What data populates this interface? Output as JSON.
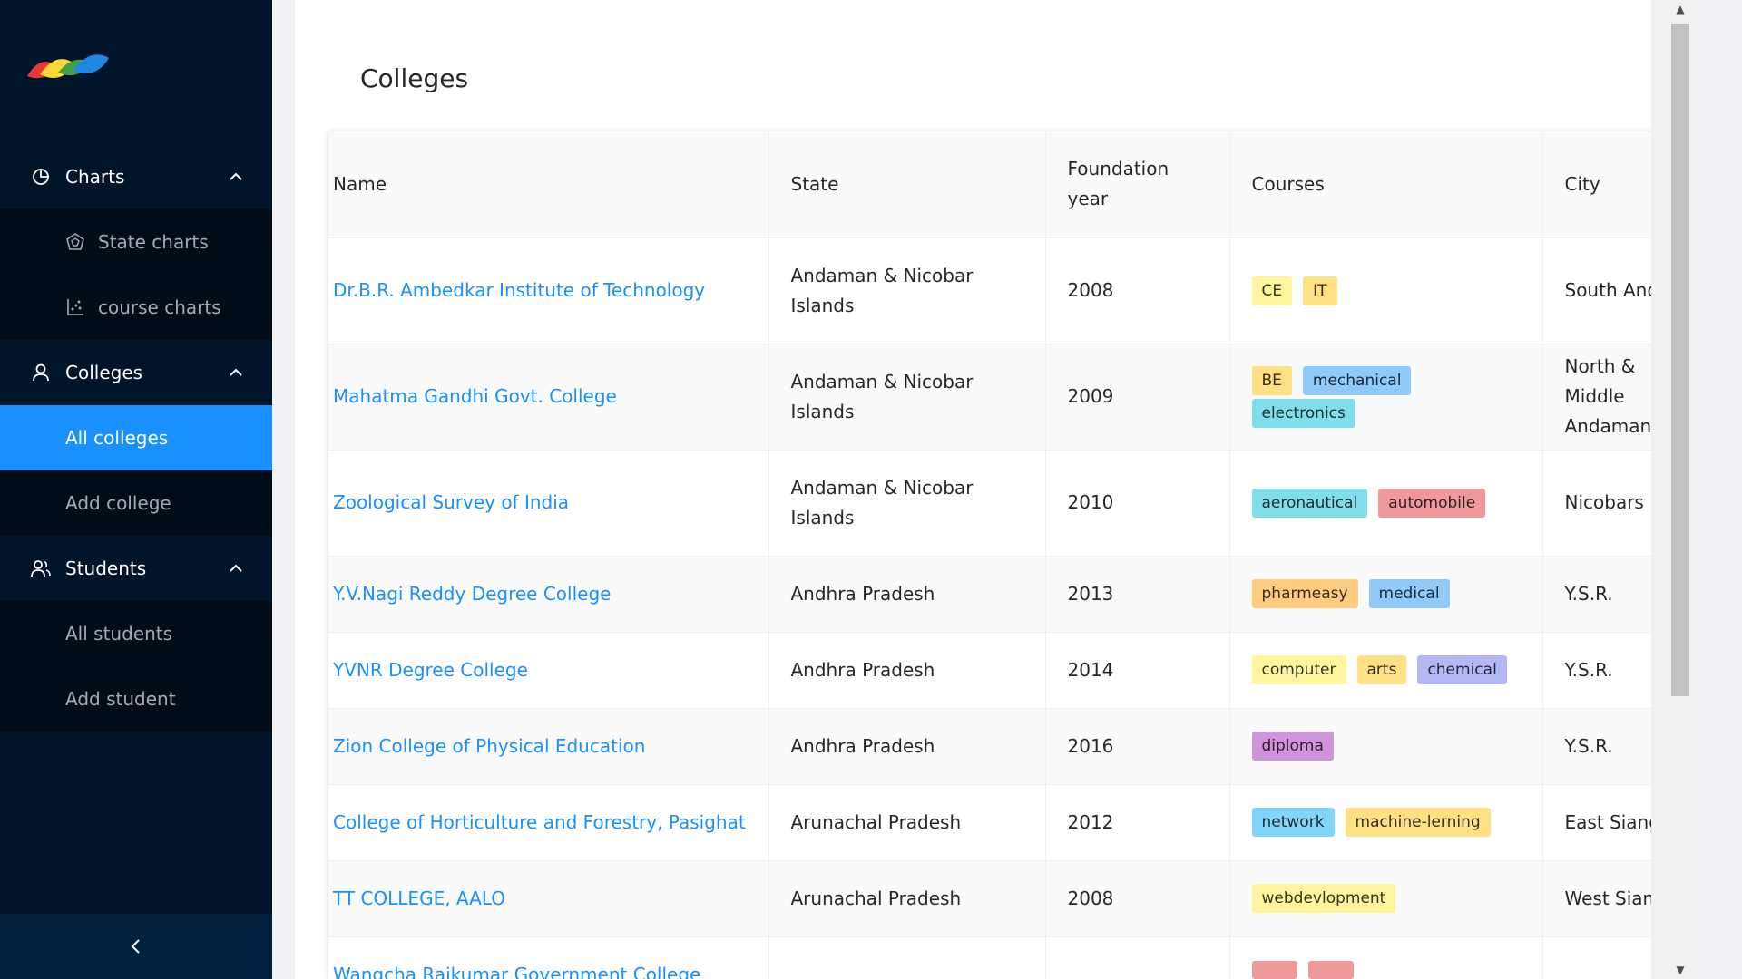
{
  "sidebar": {
    "logo_icon": "colorful-leaves-logo",
    "groups": [
      {
        "label": "Charts",
        "icon": "pie-chart-icon",
        "items": [
          {
            "label": "State charts",
            "icon": "radar-chart-icon"
          },
          {
            "label": "course charts",
            "icon": "scatter-chart-icon"
          }
        ]
      },
      {
        "label": "Colleges",
        "icon": "user-icon",
        "items": [
          {
            "label": "All colleges",
            "active": true
          },
          {
            "label": "Add college"
          }
        ]
      },
      {
        "label": "Students",
        "icon": "team-icon",
        "items": [
          {
            "label": "All students"
          },
          {
            "label": "Add student"
          }
        ]
      }
    ],
    "collapse_icon": "chevron-left-icon"
  },
  "page": {
    "title": "Colleges"
  },
  "table": {
    "columns": [
      "Name",
      "State",
      "Foundation year",
      "Courses",
      "City"
    ],
    "rows": [
      {
        "name": "Dr.B.R. Ambedkar Institute of Technology",
        "state": "Andaman & Nicobar Islands",
        "year": "2008",
        "courses": [
          "CE",
          "IT"
        ],
        "city": "South Andaman"
      },
      {
        "name": "Mahatma Gandhi Govt. College",
        "state": "Andaman & Nicobar Islands",
        "year": "2009",
        "courses": [
          "BE",
          "mechanical",
          "electronics"
        ],
        "city": "North & Middle Andaman"
      },
      {
        "name": "Zoological Survey of India",
        "state": "Andaman & Nicobar Islands",
        "year": "2010",
        "courses": [
          "aeronautical",
          "automobile"
        ],
        "city": "Nicobars"
      },
      {
        "name": "Y.V.Nagi Reddy Degree College",
        "state": "Andhra Pradesh",
        "year": "2013",
        "courses": [
          "pharmeasy",
          "medical"
        ],
        "city": "Y.S.R."
      },
      {
        "name": "YVNR Degree College",
        "state": "Andhra Pradesh",
        "year": "2014",
        "courses": [
          "computer",
          "arts",
          "chemical"
        ],
        "city": "Y.S.R."
      },
      {
        "name": "Zion College of Physical Education",
        "state": "Andhra Pradesh",
        "year": "2016",
        "courses": [
          "diploma"
        ],
        "city": "Y.S.R."
      },
      {
        "name": "College of Horticulture and Forestry, Pasighat",
        "state": "Arunachal Pradesh",
        "year": "2012",
        "courses": [
          "network",
          "machine-lerning"
        ],
        "city": "East Siang"
      },
      {
        "name": "TT COLLEGE, AALO",
        "state": "Arunachal Pradesh",
        "year": "2008",
        "courses": [
          "webdevlopment"
        ],
        "city": "West Siang"
      },
      {
        "name": "Wangcha Rajkumar Government College",
        "state": "",
        "year": "",
        "courses": [
          "",
          ""
        ],
        "city": ""
      }
    ]
  },
  "tag_colors": {
    "CE": "#fff59d",
    "IT": "#ffe082",
    "BE": "#ffe082",
    "mechanical": "#90caf9",
    "electronics": "#80deea",
    "aeronautical": "#80deea",
    "automobile": "#ef9a9a",
    "pharmeasy": "#ffcc80",
    "medical": "#90caf9",
    "computer": "#fff59d",
    "arts": "#ffe082",
    "chemical": "#b3b8f5",
    "diploma": "#ce93d8",
    "network": "#81d4fa",
    "machine-lerning": "#ffe082",
    "webdevlopment": "#fff59d"
  }
}
